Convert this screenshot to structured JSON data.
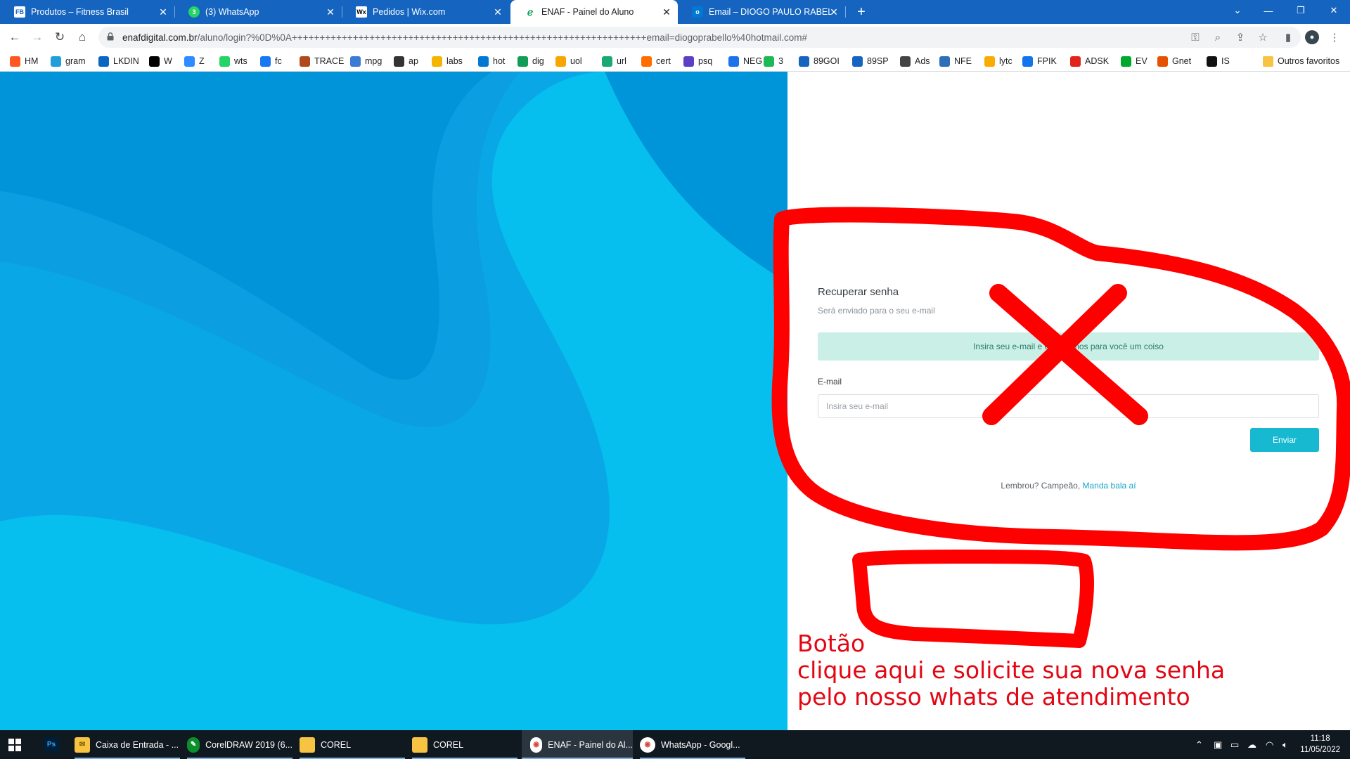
{
  "browser": {
    "tabs": [
      {
        "title": "Produtos – Fitness Brasil",
        "icon": "fb-icon",
        "active": false
      },
      {
        "title": "(3) WhatsApp",
        "icon": "whatsapp-icon",
        "active": false
      },
      {
        "title": "Pedidos | Wix.com",
        "icon": "wix-icon",
        "active": false
      },
      {
        "title": "ENAF - Painel do Aluno",
        "icon": "enaf-icon",
        "active": true
      },
      {
        "title": "Email – DIOGO PAULO RABELLO",
        "icon": "outlook-icon",
        "active": false
      }
    ],
    "new_tab_label": "+",
    "url_host": "enafdigital.com.br",
    "url_path": "/aluno/login?%0D%0A++++++++++++++++++++++++++++++++++++++++++++++++++++++++++++++++email=diogoprabello%40hotmail.com#",
    "bookmarks": [
      {
        "label": "HM",
        "color": "#ff5722"
      },
      {
        "label": "gram",
        "color": "#229ed9"
      },
      {
        "label": "LKDIN",
        "color": "#0a66c2"
      },
      {
        "label": "W",
        "color": "#000000"
      },
      {
        "label": "Z",
        "color": "#2d8cff"
      },
      {
        "label": "wts",
        "color": "#25d366"
      },
      {
        "label": "fc",
        "color": "#1877f2"
      },
      {
        "label": "TRACE",
        "color": "#b04a1e"
      },
      {
        "label": "mpg",
        "color": "#3a7bd5"
      },
      {
        "label": "ap",
        "color": "#333333"
      },
      {
        "label": "labs",
        "color": "#f4b400"
      },
      {
        "label": "hot",
        "color": "#0078d4"
      },
      {
        "label": "dig",
        "color": "#0f9d58"
      },
      {
        "label": "uol",
        "color": "#f7a600"
      },
      {
        "label": "url",
        "color": "#19a974"
      },
      {
        "label": "cert",
        "color": "#ff6d00"
      },
      {
        "label": "psq",
        "color": "#5b3fc4"
      },
      {
        "label": "NEG",
        "color": "#1a73e8"
      },
      {
        "label": "3",
        "color": "#1db954"
      },
      {
        "label": "89GOI",
        "color": "#1565c0"
      },
      {
        "label": "89SP",
        "color": "#1565c0"
      },
      {
        "label": "Ads",
        "color": "#444444"
      },
      {
        "label": "NFE",
        "color": "#2e6fb7"
      },
      {
        "label": "lytc",
        "color": "#f9ab00"
      },
      {
        "label": "FPIK",
        "color": "#1273eb"
      },
      {
        "label": "ADSK",
        "color": "#e1251b"
      },
      {
        "label": "EV",
        "color": "#00a82d"
      },
      {
        "label": "Gnet",
        "color": "#e65100"
      },
      {
        "label": "IS",
        "color": "#111111"
      }
    ],
    "other_favorites": "Outros favoritos"
  },
  "page": {
    "title": "Recuperar senha",
    "subtitle": "Será enviado para o seu e-mail",
    "alert_text": "Insira seu e-mail e enviaremos para você um coiso",
    "email_label": "E-mail",
    "email_placeholder": "Insira seu e-mail",
    "send_button": "Enviar",
    "remember_text": "Lembrou? Campeão,",
    "remember_link": "Manda bala aí",
    "accent_color": "#16b9d0"
  },
  "annotation": {
    "lines": [
      "Botão",
      "clique aqui e solicite sua nova senha",
      "pelo nosso whats de atendimento"
    ],
    "color": "#e30613"
  },
  "taskbar": {
    "items": [
      {
        "label": "",
        "icon": "photoshop-icon"
      },
      {
        "label": "Caixa de Entrada - ...",
        "icon": "mail-folder-icon"
      },
      {
        "label": "CorelDRAW 2019 (6...",
        "icon": "coreldraw-icon"
      },
      {
        "label": "COREL",
        "icon": "folder-icon"
      },
      {
        "label": "COREL",
        "icon": "folder-icon"
      },
      {
        "label": "ENAF - Painel do Al...",
        "icon": "chrome-icon"
      },
      {
        "label": "WhatsApp - Googl...",
        "icon": "chrome-icon"
      }
    ],
    "time": "11:18",
    "date": "11/05/2022"
  }
}
